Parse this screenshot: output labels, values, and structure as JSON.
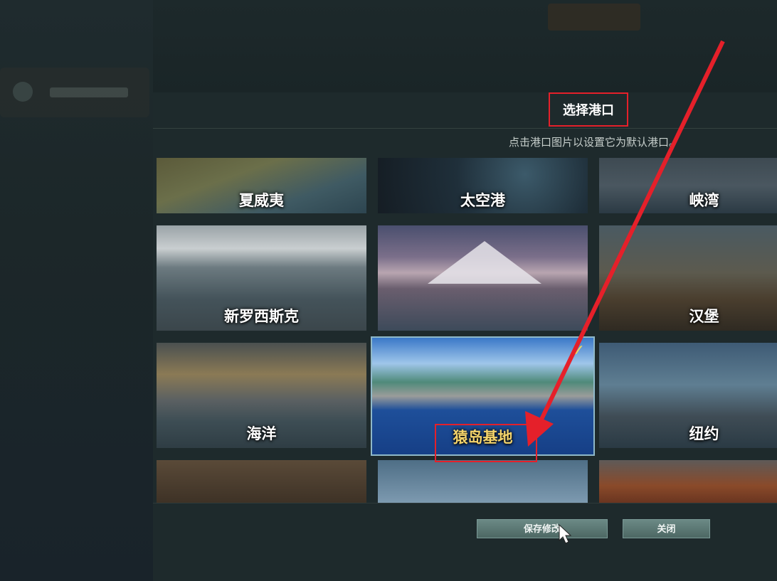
{
  "dialog": {
    "title": "选择港口",
    "subtitle": "点击港口图片以设置它为默认港口。"
  },
  "ports": [
    {
      "label": "夏威夷",
      "selected": false
    },
    {
      "label": "太空港",
      "selected": false
    },
    {
      "label": "峡湾",
      "selected": false
    },
    {
      "label": "新罗西斯克",
      "selected": false
    },
    {
      "label": "",
      "selected": false
    },
    {
      "label": "汉堡",
      "selected": false
    },
    {
      "label": "海洋",
      "selected": false
    },
    {
      "label": "猿岛基地",
      "selected": true
    },
    {
      "label": "纽约",
      "selected": false
    },
    {
      "label": "",
      "selected": false
    },
    {
      "label": "",
      "selected": false
    },
    {
      "label": "",
      "selected": false
    }
  ],
  "buttons": {
    "save": "保存修改",
    "close": "关闭"
  },
  "colors": {
    "annotation": "#e5202a",
    "selected_label": "#f3d36b",
    "button": "#5c7a76"
  },
  "icons": {
    "selected_check": "✓",
    "cursor": "mouse-pointer-icon"
  }
}
